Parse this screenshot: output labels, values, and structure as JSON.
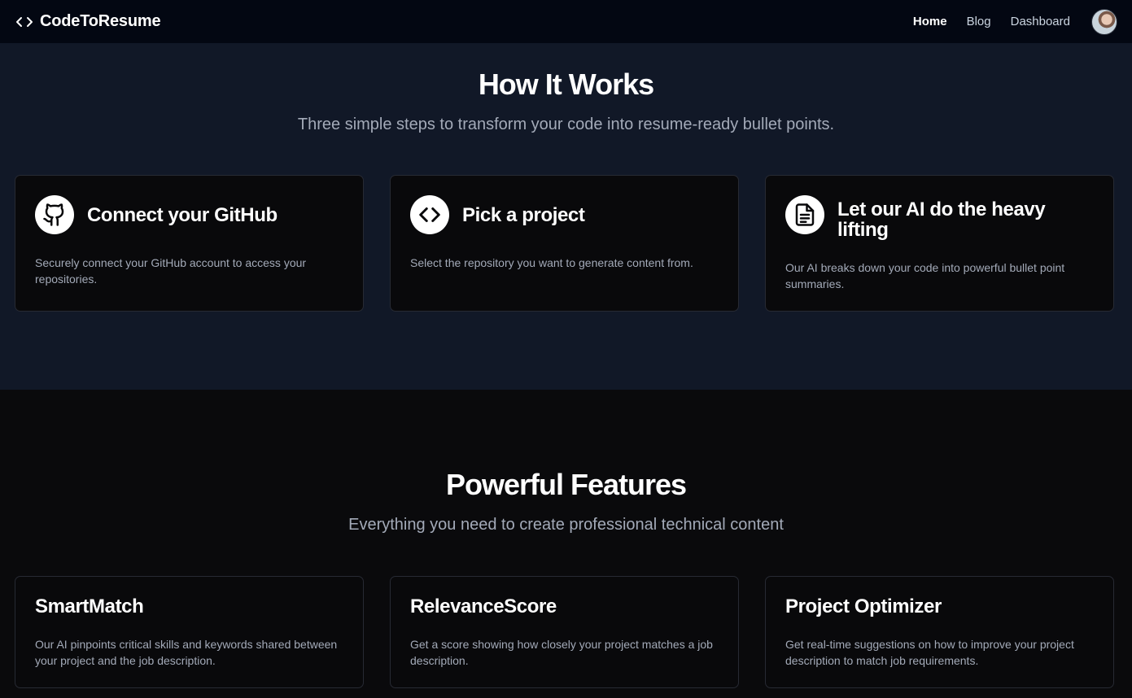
{
  "nav": {
    "brand": "CodeToResume",
    "brand_icon": "code-brackets-icon",
    "links": [
      {
        "label": "Home",
        "active": true
      },
      {
        "label": "Blog",
        "active": false
      },
      {
        "label": "Dashboard",
        "active": false
      }
    ],
    "avatar": "user-avatar"
  },
  "how_it_works": {
    "title": "How It Works",
    "subtitle": "Three simple steps to transform your code into resume-ready bullet points.",
    "steps": [
      {
        "icon": "github-icon",
        "title": "Connect your GitHub",
        "description": "Securely connect your GitHub account to access your repositories."
      },
      {
        "icon": "code-icon",
        "title": "Pick a project",
        "description": "Select the repository you want to generate content from."
      },
      {
        "icon": "document-icon",
        "title": "Let our AI do the heavy lifting",
        "description": "Our AI breaks down your code into powerful bullet point summaries."
      }
    ]
  },
  "features": {
    "title": "Powerful Features",
    "subtitle": "Everything you need to create professional technical content",
    "items": [
      {
        "title": "SmartMatch",
        "description": "Our AI pinpoints critical skills and keywords shared between your project and the job description."
      },
      {
        "title": "RelevanceScore",
        "description": "Get a score showing how closely your project matches a job description."
      },
      {
        "title": "Project Optimizer",
        "description": "Get real-time suggestions on how to improve your project description to match job requirements."
      }
    ]
  },
  "colors": {
    "nav_bg": "#030712",
    "how_bg": "#111827",
    "features_bg": "#0a0a0c",
    "card_bg": "#09090b",
    "muted_text": "#a3aab8"
  }
}
